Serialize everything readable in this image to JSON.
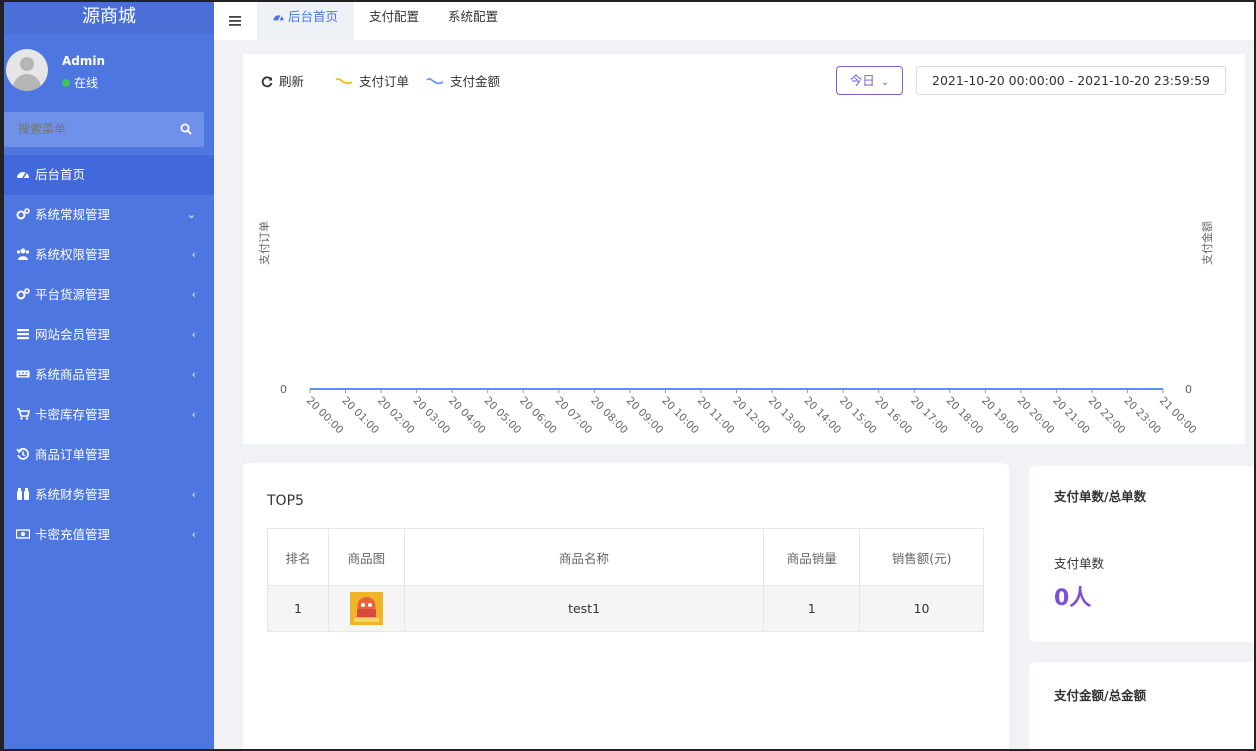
{
  "app": {
    "title": "源商城"
  },
  "user": {
    "name": "Admin",
    "status": "在线"
  },
  "search": {
    "placeholder": "搜索菜单"
  },
  "sidebar": {
    "items": [
      {
        "label": "后台首页",
        "icon": "dashboard-icon",
        "arrow": ""
      },
      {
        "label": "系统常规管理",
        "icon": "cogs-icon",
        "arrow": "⌄"
      },
      {
        "label": "系统权限管理",
        "icon": "users-icon",
        "arrow": "‹"
      },
      {
        "label": "平台货源管理",
        "icon": "cogs-icon",
        "arrow": "‹"
      },
      {
        "label": "网站会员管理",
        "icon": "list-icon",
        "arrow": "‹"
      },
      {
        "label": "系统商品管理",
        "icon": "keyboard-icon",
        "arrow": "‹"
      },
      {
        "label": "卡密库存管理",
        "icon": "cart-icon",
        "arrow": "‹"
      },
      {
        "label": "商品订单管理",
        "icon": "history-icon",
        "arrow": ""
      },
      {
        "label": "系统财务管理",
        "icon": "binoculars-icon",
        "arrow": "‹"
      },
      {
        "label": "卡密充值管理",
        "icon": "money-icon",
        "arrow": "‹"
      }
    ]
  },
  "tabs": [
    {
      "label": "后台首页"
    },
    {
      "label": "支付配置"
    },
    {
      "label": "系统配置"
    }
  ],
  "chart_toolbar": {
    "refresh": "刷新",
    "legend_orders": "支付订单",
    "legend_amount": "支付金额",
    "today": "今日",
    "date_range": "2021-10-20 00:00:00  -  2021-10-20 23:59:59"
  },
  "chart_data": {
    "type": "line",
    "x": [
      "20 00:00",
      "20 01:00",
      "20 02:00",
      "20 03:00",
      "20 04:00",
      "20 05:00",
      "20 06:00",
      "20 07:00",
      "20 08:00",
      "20 09:00",
      "20 10:00",
      "20 11:00",
      "20 12:00",
      "20 13:00",
      "20 14:00",
      "20 15:00",
      "20 16:00",
      "20 17:00",
      "20 18:00",
      "20 19:00",
      "20 20:00",
      "20 21:00",
      "20 22:00",
      "20 23:00",
      "21 00:00"
    ],
    "series": [
      {
        "name": "支付订单",
        "axis": "left",
        "color": "#f5b800",
        "values": [
          0,
          0,
          0,
          0,
          0,
          0,
          0,
          0,
          0,
          0,
          0,
          0,
          0,
          0,
          0,
          0,
          0,
          0,
          0,
          0,
          0,
          0,
          0,
          0,
          0
        ]
      },
      {
        "name": "支付金额",
        "axis": "right",
        "color": "#5b8ff9",
        "values": [
          0,
          0,
          0,
          0,
          0,
          0,
          0,
          0,
          0,
          0,
          0,
          0,
          0,
          0,
          0,
          0,
          0,
          0,
          0,
          0,
          0,
          0,
          0,
          0,
          0
        ]
      }
    ],
    "ylabel_left": "支付订单",
    "ylabel_right": "支付金额",
    "y_tick_left": "0",
    "y_tick_right": "0",
    "grid": false,
    "legend": "top-left"
  },
  "top5": {
    "title": "TOP5",
    "headers": [
      "排名",
      "商品图",
      "商品名称",
      "商品销量",
      "销售额(元)"
    ],
    "rows": [
      {
        "rank": "1",
        "name": "test1",
        "sales": "1",
        "amount": "10"
      }
    ]
  },
  "stats": {
    "count_title": "支付单数/总单数",
    "count_label": "支付单数",
    "count_value": "0人",
    "amount_title": "支付金额/总金额"
  },
  "colors": {
    "sidebar": "#4e76e0",
    "accent_purple": "#7b4fd8",
    "series_orders": "#f5b800",
    "series_amount": "#5b8ff9"
  }
}
